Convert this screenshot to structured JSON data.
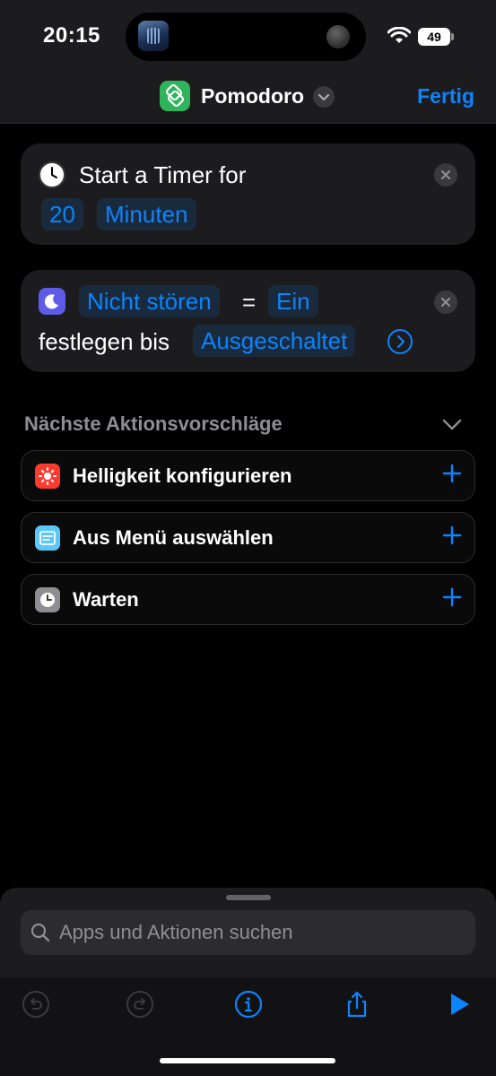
{
  "status_bar": {
    "time": "20:15",
    "battery": "49"
  },
  "header": {
    "title": "Pomodoro",
    "done_label": "Fertig"
  },
  "actions": [
    {
      "line1": "Start a Timer for",
      "value": "20",
      "unit": "Minuten"
    },
    {
      "token1": "Nicht stören",
      "equals": "=",
      "token2": "Ein",
      "line2": "festlegen bis",
      "token3": "Ausgeschaltet"
    }
  ],
  "suggestions": {
    "heading": "Nächste Aktionsvorschläge",
    "items": [
      {
        "label": "Helligkeit konfigurieren",
        "icon": "brightness-icon",
        "color": "#ff3b30"
      },
      {
        "label": "Aus Menü auswählen",
        "icon": "menu-icon",
        "color": "#5ac8fa"
      },
      {
        "label": "Warten",
        "icon": "clock-icon",
        "color": "#8e8e93"
      }
    ]
  },
  "search": {
    "placeholder": "Apps und Aktionen suchen"
  },
  "colors": {
    "accent": "#0a84ff",
    "background": "#000000",
    "card": "#1c1c1e"
  }
}
